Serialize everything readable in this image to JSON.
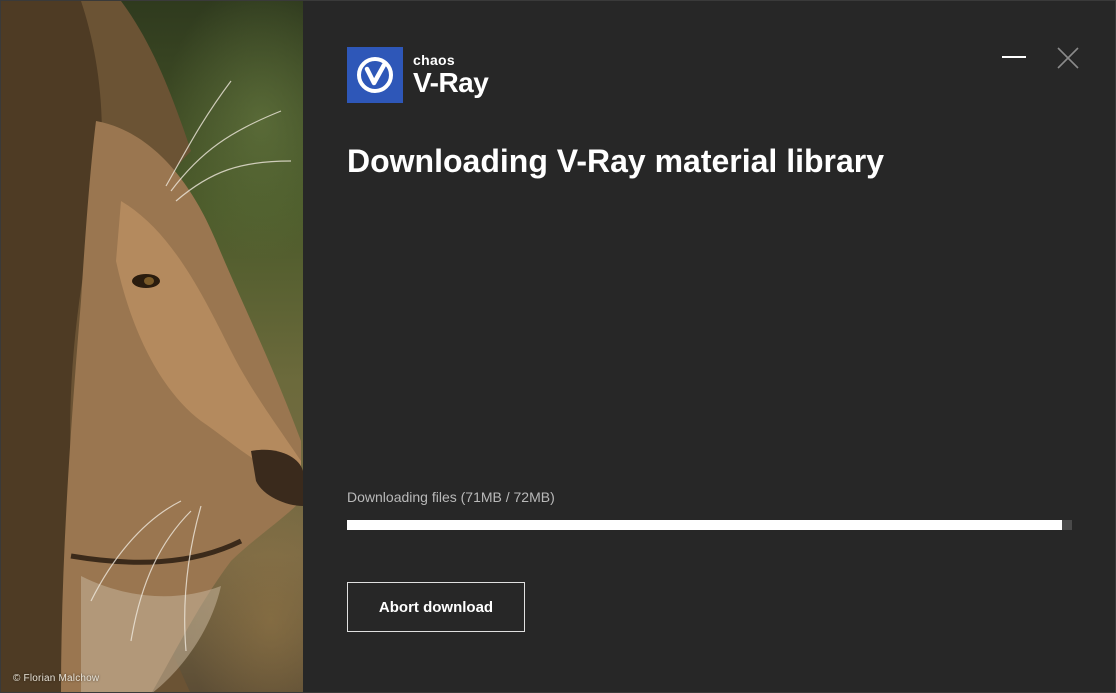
{
  "photo": {
    "credit": "© Florian Malchow",
    "subject_icon": "lion-photo"
  },
  "logo": {
    "icon": "vray-logo-icon",
    "brand": "chaos",
    "product": "V-Ray",
    "color": "#2e57b8"
  },
  "window_controls": {
    "minimize_icon": "minimize-icon",
    "close_icon": "close-icon"
  },
  "title": "Downloading V-Ray material library",
  "download": {
    "status_text": "Downloading files (71MB / 72MB)",
    "progress_fraction": 0.986
  },
  "actions": {
    "abort_label": "Abort download"
  },
  "colors": {
    "background": "#272727",
    "accent": "#2e57b8",
    "progress_fill": "#ffffff",
    "progress_track": "#4a4a4a"
  }
}
